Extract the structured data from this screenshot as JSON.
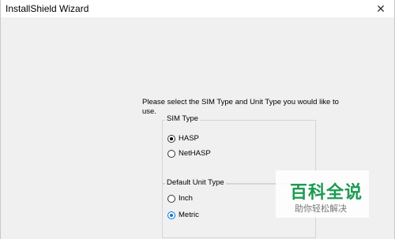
{
  "window": {
    "title": "InstallShield Wizard",
    "close_glyph": "✕"
  },
  "main": {
    "instruction": "Please select the SIM Type and Unit Type you would like to use.",
    "sim_type": {
      "legend": "SIM Type",
      "options": [
        {
          "label": "HASP",
          "checked": true
        },
        {
          "label": "NetHASP",
          "checked": false
        }
      ]
    },
    "unit_type": {
      "legend": "Default Unit Type",
      "options": [
        {
          "label": "Inch",
          "checked": false
        },
        {
          "label": "Metric",
          "checked": true
        }
      ]
    }
  },
  "watermark": {
    "logo": "百科全说",
    "subtitle": "助你轻松解决"
  },
  "colors": {
    "accent": "#0078d7",
    "watermark_green": "#1c9a52"
  }
}
